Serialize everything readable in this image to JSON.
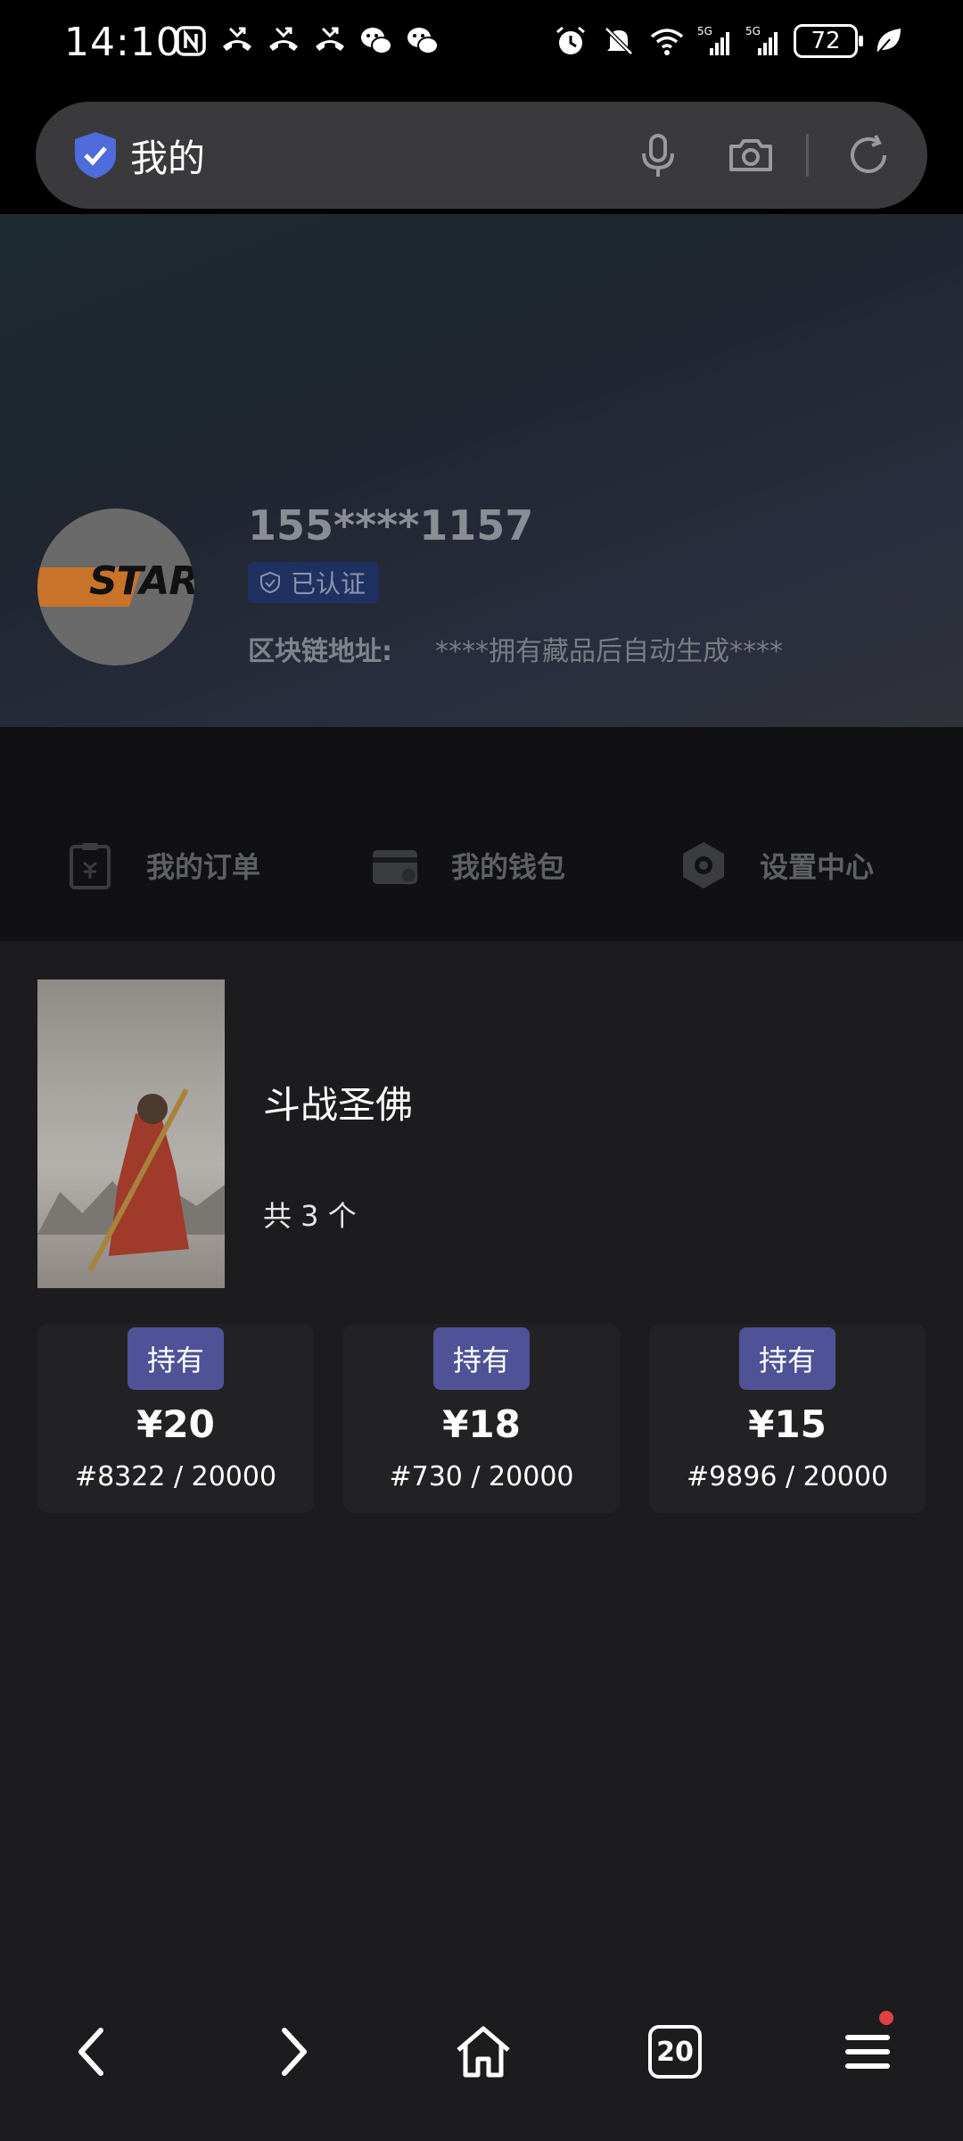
{
  "status_bar": {
    "time": "14:10",
    "battery": "72",
    "left_icons": [
      "nfc-icon",
      "missed-call-icon",
      "missed-call-icon",
      "missed-call-icon",
      "wechat-icon",
      "wechat-icon"
    ],
    "right_icons": [
      "alarm-icon",
      "mute-icon",
      "wifi-icon",
      "signal-5g-icon",
      "signal-5g-icon",
      "leaf-icon"
    ]
  },
  "search": {
    "text": "我的"
  },
  "profile": {
    "phone": "155****1157",
    "verified_label": "已认证",
    "chain_label": "区块链地址:",
    "chain_value": "****拥有藏品后自动生成****",
    "avatar_text": "STAR"
  },
  "quick_nav": [
    {
      "label": "我的订单",
      "icon": "order-icon"
    },
    {
      "label": "我的钱包",
      "icon": "wallet-icon"
    },
    {
      "label": "设置中心",
      "icon": "settings-icon"
    }
  ],
  "collection": {
    "name": "斗战圣佛",
    "count": "共 3 个",
    "items": [
      {
        "badge": "持有",
        "price": "¥20",
        "serial": "#8322 / 20000"
      },
      {
        "badge": "持有",
        "price": "¥18",
        "serial": "#730 / 20000"
      },
      {
        "badge": "持有",
        "price": "¥15",
        "serial": "#9896 / 20000"
      }
    ]
  },
  "bottom_nav": {
    "tabs_count": "20"
  },
  "colors": {
    "badge": "#4f5296",
    "background": "#1c1c1e",
    "verified_bg": "#1f3160"
  }
}
